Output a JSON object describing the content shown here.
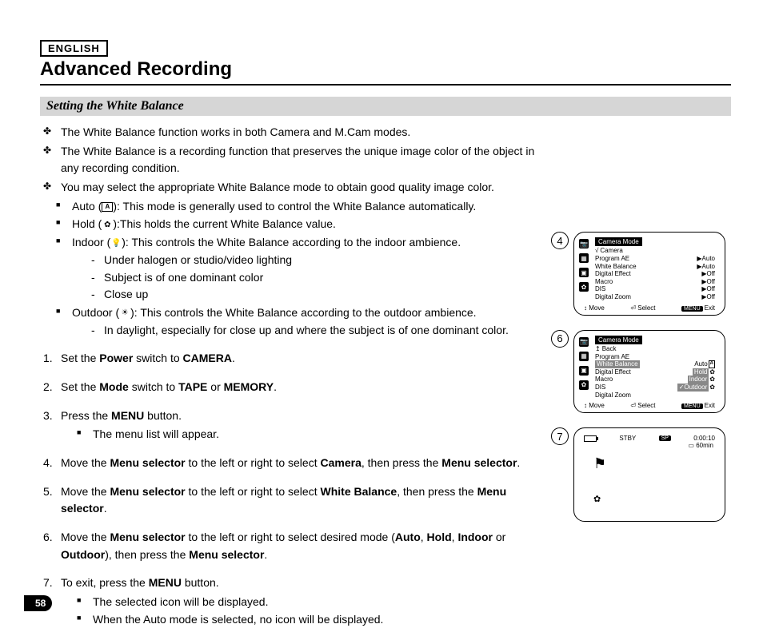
{
  "lang": "ENGLISH",
  "title": "Advanced Recording",
  "section": "Setting the White Balance",
  "bullets": {
    "b1": "The White Balance function works in both Camera and M.Cam modes.",
    "b2": "The White Balance is a recording function that preserves the unique image color of the object in any recording condition.",
    "b3": "You may select the appropriate White Balance mode to obtain good quality image color."
  },
  "modes": {
    "auto_pre": "Auto (",
    "auto_post": "): This mode is generally used to control the White Balance automatically.",
    "hold_pre": "Hold (",
    "hold_post": "):This holds the current White Balance value.",
    "indoor_pre": "Indoor (",
    "indoor_post": "): This controls the White Balance according to the indoor ambience.",
    "outdoor_pre": "Outdoor (",
    "outdoor_post": "): This controls the White Balance according to the outdoor ambience."
  },
  "dashes": {
    "d1": "Under halogen or studio/video lighting",
    "d2": "Subject is of one dominant color",
    "d3": "Close up",
    "d4": "In daylight, especially for close up and where the subject is of one dominant color."
  },
  "steps": {
    "s1a": "Set the ",
    "s1b": "Power",
    "s1c": " switch to ",
    "s1d": "CAMERA",
    "s1e": ".",
    "s2a": "Set the ",
    "s2b": "Mode",
    "s2c": " switch to ",
    "s2d": "TAPE",
    "s2e": " or ",
    "s2f": "MEMORY",
    "s2g": ".",
    "s3a": "Press the ",
    "s3b": "MENU",
    "s3c": " button.",
    "s3sub": "The menu list will appear.",
    "s4a": "Move the ",
    "s4b": "Menu selector",
    "s4c": " to the left or right to select ",
    "s4d": "Camera",
    "s4e": ", then press the ",
    "s4f": "Menu selector",
    "s4g": ".",
    "s5a": "Move the ",
    "s5b": "Menu selector",
    "s5c": " to the left or right to select ",
    "s5d": "White Balance",
    "s5e": ", then press the ",
    "s5f": "Menu selector",
    "s5g": ".",
    "s6a": "Move the ",
    "s6b": "Menu selector",
    "s6c": " to the left or right to select desired mode (",
    "s6d": "Auto",
    "s6e": ", ",
    "s6f": "Hold",
    "s6g": ", ",
    "s6h": "Indoor",
    "s6i": " or ",
    "s6j": "Outdoor",
    "s6k": "), then press the ",
    "s6l": "Menu selector",
    "s6m": ".",
    "s7a": "To exit, press the ",
    "s7b": "MENU",
    "s7c": " button.",
    "s7sub1": "The selected icon will be displayed.",
    "s7sub2": "When the Auto mode is selected, no icon will be displayed."
  },
  "fig4": {
    "num": "4",
    "title": "Camera Mode",
    "sub": "Camera",
    "rows": [
      {
        "l": "Program AE",
        "r": "Auto"
      },
      {
        "l": "White Balance",
        "r": "Auto"
      },
      {
        "l": "Digital Effect",
        "r": "Off"
      },
      {
        "l": "Macro",
        "r": "Off"
      },
      {
        "l": "DIS",
        "r": "Off"
      },
      {
        "l": "Digital Zoom",
        "r": "Off"
      }
    ],
    "move": "Move",
    "select": "Select",
    "menu": "MENU",
    "exit": "Exit"
  },
  "fig6": {
    "num": "6",
    "title": "Camera Mode",
    "back": "Back",
    "rows": [
      {
        "l": "Program AE",
        "r": ""
      },
      {
        "l": "White Balance",
        "r": "Auto",
        "sel": true,
        "icon": "A"
      },
      {
        "l": "Digital Effect",
        "r": "Hold",
        "box": true
      },
      {
        "l": "Macro",
        "r": "Indoor",
        "box": true
      },
      {
        "l": "DIS",
        "r": "Outdoor",
        "box": true,
        "chk": true
      },
      {
        "l": "Digital Zoom",
        "r": ""
      }
    ],
    "move": "Move",
    "select": "Select",
    "menu": "MENU",
    "exit": "Exit"
  },
  "fig7": {
    "num": "7",
    "stby": "STBY",
    "sp": "SP",
    "time": "0:00:10",
    "remain": "60min"
  },
  "pageNum": "58"
}
